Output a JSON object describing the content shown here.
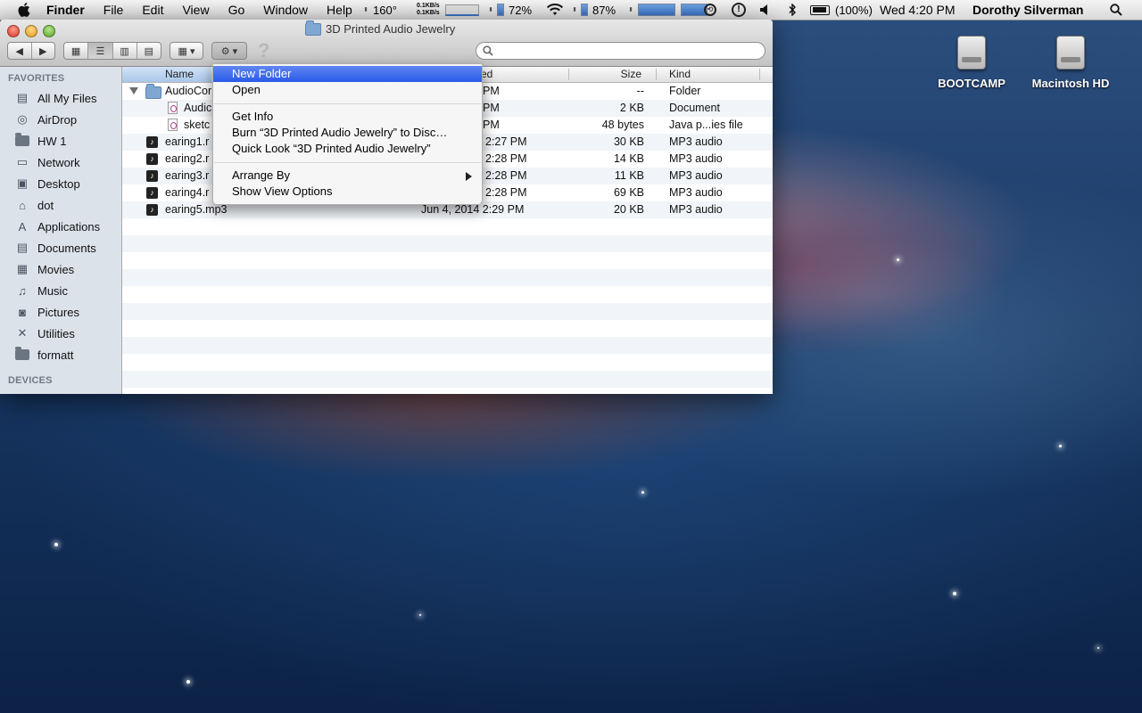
{
  "menubar": {
    "app_name": "Finder",
    "menus": [
      "File",
      "Edit",
      "View",
      "Go",
      "Window",
      "Help"
    ],
    "temp": "160°",
    "net_up": "0.1KB/s",
    "net_down": "0.1KB/s",
    "mem_percent": "72%",
    "battery_percent": "87%",
    "battery_full": "(100%)",
    "clock": "Wed 4:20 PM",
    "user": "Dorothy Silverman"
  },
  "window": {
    "title": "3D Printed Audio Jewelry",
    "help_glyph": "?"
  },
  "sidebar": {
    "favorites_header": "FAVORITES",
    "devices_header": "DEVICES",
    "items": [
      {
        "label": "All My Files",
        "icon": "all-files-icon"
      },
      {
        "label": "AirDrop",
        "icon": "airdrop-icon"
      },
      {
        "label": "HW 1",
        "icon": "folder-icon"
      },
      {
        "label": "Network",
        "icon": "network-icon"
      },
      {
        "label": "Desktop",
        "icon": "desktop-icon"
      },
      {
        "label": "dot",
        "icon": "home-icon"
      },
      {
        "label": "Applications",
        "icon": "applications-icon"
      },
      {
        "label": "Documents",
        "icon": "documents-icon"
      },
      {
        "label": "Movies",
        "icon": "movies-icon"
      },
      {
        "label": "Music",
        "icon": "music-icon"
      },
      {
        "label": "Pictures",
        "icon": "pictures-icon"
      },
      {
        "label": "Utilities",
        "icon": "utilities-icon"
      },
      {
        "label": "formatt",
        "icon": "folder-icon"
      }
    ]
  },
  "columns": {
    "name": "Name",
    "date": "ed",
    "size": "Size",
    "kind": "Kind"
  },
  "rows": [
    {
      "name": "AudioCor",
      "date": "PM",
      "size": "--",
      "kind": "Folder",
      "icon": "folder-icon"
    },
    {
      "name": "Audic",
      "date": "PM",
      "size": "2 KB",
      "kind": "Document",
      "icon": "document-icon"
    },
    {
      "name": "sketc",
      "date": "PM",
      "size": "48 bytes",
      "kind": "Java p...ies file",
      "icon": "document-icon"
    },
    {
      "name": "earing1.r",
      "date": "2:27 PM",
      "size": "30 KB",
      "kind": "MP3 audio",
      "icon": "mp3-icon"
    },
    {
      "name": "earing2.r",
      "date": "2:28 PM",
      "size": "14 KB",
      "kind": "MP3 audio",
      "icon": "mp3-icon"
    },
    {
      "name": "earing3.r",
      "date": "2:28 PM",
      "size": "11 KB",
      "kind": "MP3 audio",
      "icon": "mp3-icon"
    },
    {
      "name": "earing4.r",
      "date": "2:28 PM",
      "size": "69 KB",
      "kind": "MP3 audio",
      "icon": "mp3-icon"
    },
    {
      "name": "earing5.mp3",
      "date": "Jun 4, 2014 2:29 PM",
      "size": "20 KB",
      "kind": "MP3 audio",
      "icon": "mp3-icon"
    }
  ],
  "context_menu": {
    "items": [
      "New Folder",
      "Open",
      "Get Info",
      "Burn “3D Printed Audio Jewelry” to Disc…",
      "Quick Look “3D Printed Audio Jewelry”",
      "Arrange By",
      "Show View Options"
    ],
    "highlighted": "New Folder"
  },
  "desktop": {
    "drives": [
      "BOOTCAMP",
      "Macintosh HD"
    ]
  }
}
